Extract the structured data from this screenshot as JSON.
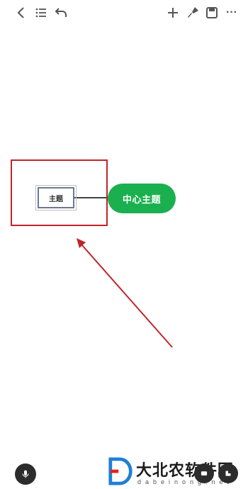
{
  "toolbar": {
    "left_icons": [
      "back-icon",
      "outline-list-icon",
      "undo-icon"
    ],
    "right_icons": [
      "add-icon",
      "brush-icon",
      "save-icon",
      "more-icon"
    ],
    "more_label": "···"
  },
  "mindmap": {
    "central_topic": "中心主题",
    "sub_topic": "主题",
    "central_color": "#1bb04f"
  },
  "annotation": {
    "highlight_color": "#c0242a"
  },
  "bottom": {
    "left_icon": "microphone-icon",
    "right_icons": [
      "layout-icon",
      "style-icon"
    ]
  },
  "watermark": {
    "logo": "D",
    "text": "大北农软件园",
    "subtext": "dabeinong.net"
  }
}
